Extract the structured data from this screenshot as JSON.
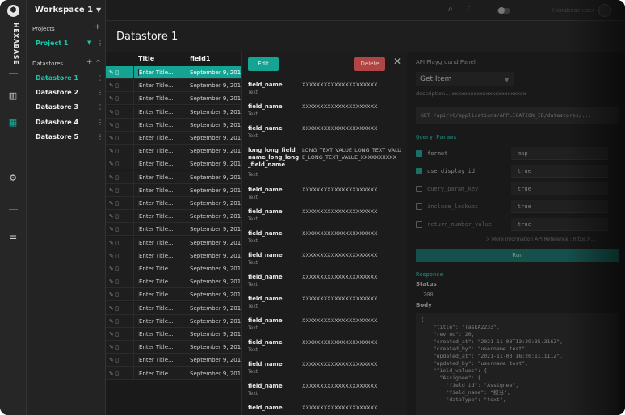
{
  "app": {
    "brand": "HEXABASE",
    "logo_glyph": "⬢"
  },
  "sidebar": {
    "workspace": "Workspace 1",
    "projects_label": "Projects",
    "projects": [
      {
        "label": "Project 1"
      }
    ],
    "datastores_label": "Datastores",
    "datastores": [
      {
        "label": "Datastore 1"
      },
      {
        "label": "Datastore 2"
      },
      {
        "label": "Datastore 3"
      },
      {
        "label": "Datastore 4"
      },
      {
        "label": "Datastore 5"
      }
    ],
    "add_glyph": "+",
    "collapse_glyph": "^",
    "kebab_glyph": "⋮"
  },
  "topbar": {
    "user_name": "Hexabase user"
  },
  "page": {
    "title": "Datastore 1"
  },
  "table": {
    "columns": [
      "Title",
      "field1"
    ],
    "row_title": "Enter Title...",
    "row_date": "September 9, 2013",
    "row_count": 24,
    "selected_row": 0
  },
  "detail": {
    "edit_label": "Edit",
    "delete_label": "Delete",
    "close_glyph": "✕",
    "fields": [
      {
        "name": "field_name",
        "type": "Text",
        "value": "XXXXXXXXXXXXXXXXXXXXX"
      },
      {
        "name": "field_name",
        "type": "Text",
        "value": "XXXXXXXXXXXXXXXXXXXXX"
      },
      {
        "name": "field_name",
        "type": "Text",
        "value": "XXXXXXXXXXXXXXXXXXXXX"
      },
      {
        "name": "long_long_field_name_long_long_field_name",
        "type": "Text",
        "value": "LONG_TEXT_VALUE_LONG_TEXT_VALUE_LONG_TEXT_VALUE_XXXXXXXXXX"
      },
      {
        "name": "field_name",
        "type": "Text",
        "value": "XXXXXXXXXXXXXXXXXXXXX"
      },
      {
        "name": "field_name",
        "type": "Text",
        "value": "XXXXXXXXXXXXXXXXXXXXX"
      },
      {
        "name": "field_name",
        "type": "Text",
        "value": "XXXXXXXXXXXXXXXXXXXXX"
      },
      {
        "name": "field_name",
        "type": "Text",
        "value": "XXXXXXXXXXXXXXXXXXXXX"
      },
      {
        "name": "field_name",
        "type": "Text",
        "value": "XXXXXXXXXXXXXXXXXXXXX"
      },
      {
        "name": "field_name",
        "type": "Text",
        "value": "XXXXXXXXXXXXXXXXXXXXX"
      },
      {
        "name": "field_name",
        "type": "Text",
        "value": "XXXXXXXXXXXXXXXXXXXXX"
      },
      {
        "name": "field_name",
        "type": "Text",
        "value": "XXXXXXXXXXXXXXXXXXXXX"
      },
      {
        "name": "field_name",
        "type": "Text",
        "value": "XXXXXXXXXXXXXXXXXXXXX"
      },
      {
        "name": "field_name",
        "type": "Text",
        "value": "XXXXXXXXXXXXXXXXXXXXX"
      },
      {
        "name": "field_name",
        "type": "",
        "value": "XXXXXXXXXXXXXXXXXXXXX"
      }
    ]
  },
  "api": {
    "panel_label": "API Playground Panel",
    "method": "Get Item",
    "description": "description... xxxxxxxxxxxxxxxxxxxxxxxx",
    "endpoint": "GET /api/v0/applications/APPLICATION_ID/datastores/...",
    "query_params_label": "Query Params",
    "params": [
      {
        "key": "format",
        "value": "map",
        "checked": true
      },
      {
        "key": "use_display_id",
        "value": "true",
        "checked": true
      },
      {
        "key": "query_param_key",
        "value": "true",
        "checked": false
      },
      {
        "key": "include_lookups",
        "value": "true",
        "checked": false
      },
      {
        "key": "return_number_value",
        "value": "true",
        "checked": false
      }
    ],
    "more_info": "> More information API Reference : https://...",
    "run_label": "Run",
    "response_label": "Response",
    "status_label": "Status",
    "status_value": "200",
    "body_label": "Body",
    "body_text": "{\n    \"title\": \"TaskA2233\",\n    \"rev_no\": 20,\n    \"created_at\": \"2021-11-03T13:29:35.316Z\",\n    \"created_by\": \"username test\",\n    \"updated_at\": \"2021-11-03T16:20:11.111Z\",\n    \"updated_by\": \"username test\",\n    \"field_values\": {\n      \"Assignee\": {\n        \"field_id\": \"Assignee\",\n        \"field_name\": \"担当\",\n        \"dataType\": \"text\","
  }
}
